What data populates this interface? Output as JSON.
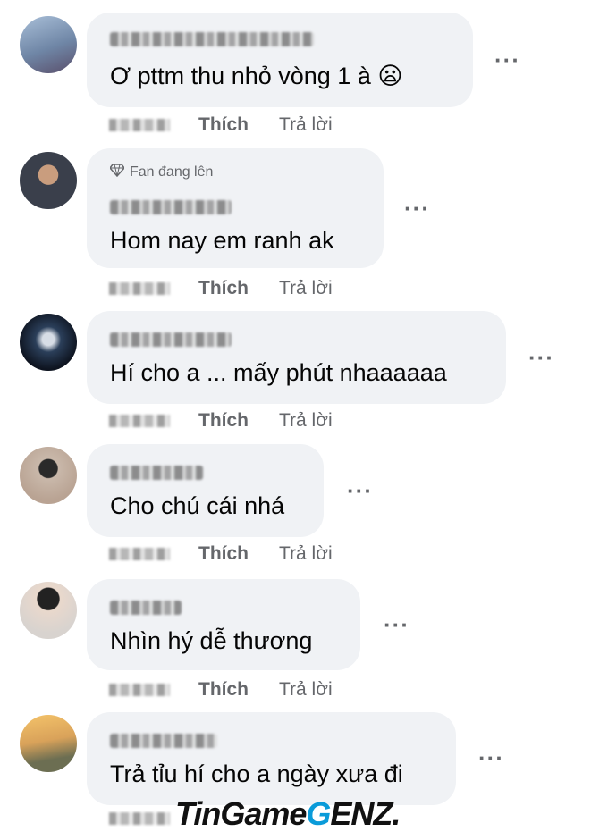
{
  "comments": [
    {
      "text": "Ơ pttm thu nhỏ vòng 1 à 😦",
      "badge": "",
      "like": "Thích",
      "reply": "Trả lời",
      "more": "···",
      "avatar_color": "#8aa3c4"
    },
    {
      "text": "Hom nay em ranh ak",
      "badge": "Fan đang lên",
      "like": "Thích",
      "reply": "Trả lời",
      "more": "···",
      "avatar_color": "#3a3f4b"
    },
    {
      "text": "Hí cho a ... mấy phút nhaaaaaa",
      "badge": "",
      "like": "Thích",
      "reply": "Trả lời",
      "more": "···",
      "avatar_color": "#1e2a3a"
    },
    {
      "text": "Cho chú cái nhá",
      "badge": "",
      "like": "Thích",
      "reply": "Trả lời",
      "more": "···",
      "avatar_color": "#c9b8aa"
    },
    {
      "text": "Nhìn hý dễ thương",
      "badge": "",
      "like": "Thích",
      "reply": "Trả lời",
      "more": "···",
      "avatar_color": "#d8d3cf"
    },
    {
      "text": "Trả tỉu hí cho a ngày xưa đi",
      "badge": "",
      "like": "Thích",
      "reply": "Trả lời",
      "more": "···",
      "avatar_color": "#d9a25a"
    }
  ],
  "badge_icon": "diamond-icon",
  "watermark": {
    "part1": "TinGame",
    "part2": "G",
    "part3": "ENZ."
  }
}
